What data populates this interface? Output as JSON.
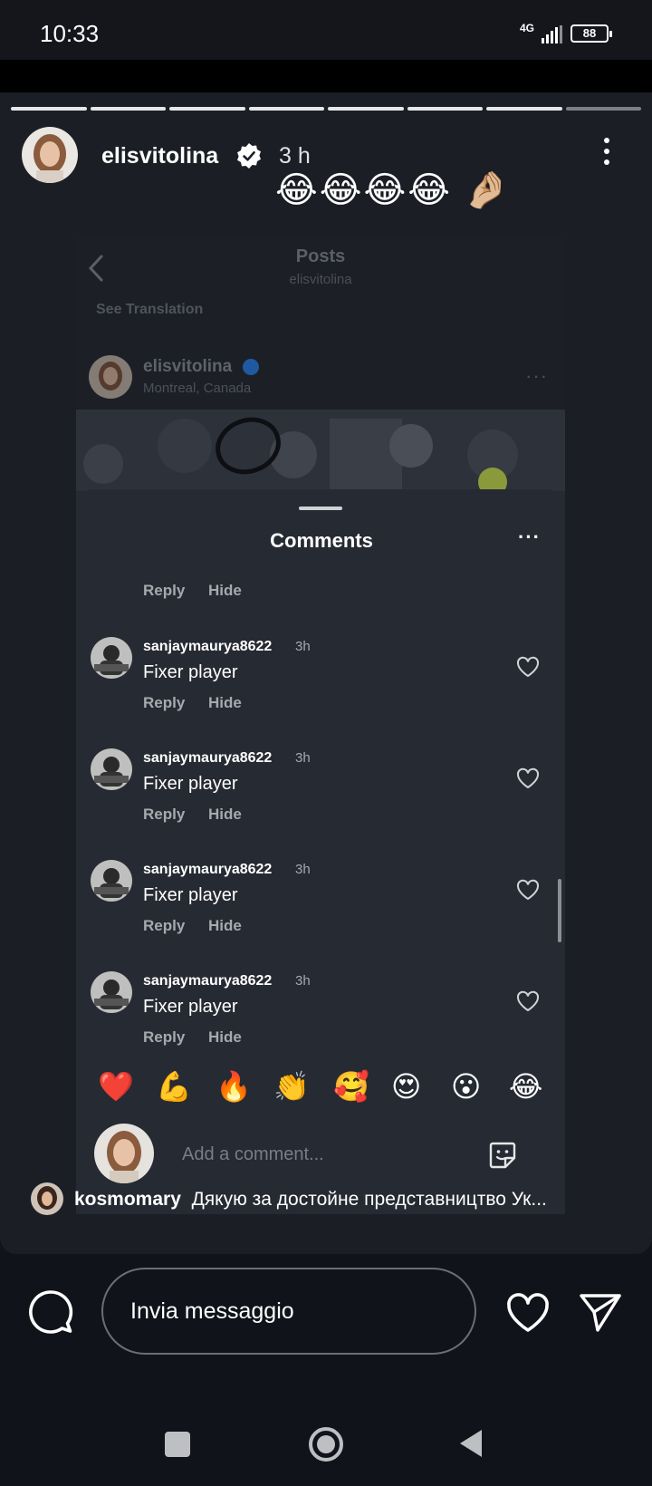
{
  "status_bar": {
    "time": "10:33",
    "network": "4G",
    "battery": "88"
  },
  "story": {
    "username": "elisvitolina",
    "time_ago": "3 h",
    "progress": {
      "segments": 8,
      "viewed": 7
    },
    "caption_emojis": "😂😂😂😂 🤌🏼"
  },
  "embedded_post": {
    "header_title": "Posts",
    "header_subtitle": "elisvitolina",
    "see_translation": "See Translation",
    "author": "elisvitolina",
    "location": "Montreal, Canada"
  },
  "comments_sheet": {
    "title": "Comments",
    "top_reply": {
      "reply": "Reply",
      "hide": "Hide"
    },
    "comments": [
      {
        "user": "sanjaymaurya8622",
        "time": "3h",
        "text": "Fixer player",
        "reply": "Reply",
        "hide": "Hide"
      },
      {
        "user": "sanjaymaurya8622",
        "time": "3h",
        "text": "Fixer player",
        "reply": "Reply",
        "hide": "Hide"
      },
      {
        "user": "sanjaymaurya8622",
        "time": "3h",
        "text": "Fixer player",
        "reply": "Reply",
        "hide": "Hide"
      },
      {
        "user": "sanjaymaurya8622",
        "time": "3h",
        "text": "Fixer player",
        "reply": "Reply",
        "hide": "Hide"
      }
    ],
    "reactions": [
      "❤️",
      "💪",
      "🔥",
      "👏",
      "🥰",
      "😍",
      "😮",
      "😂"
    ],
    "add_comment_placeholder": "Add a comment..."
  },
  "overlay_comment": {
    "user": "kosmomary",
    "text": "Дякую за достойне представництво Ук..."
  },
  "reply_bar": {
    "placeholder": "Invia messaggio"
  },
  "icons": [
    "verified-badge-icon",
    "more-vert-icon",
    "chevron-left-icon",
    "heart-icon",
    "sticker-icon",
    "chat-bubble-icon",
    "send-icon",
    "nav-recents-icon",
    "nav-home-icon",
    "nav-back-icon"
  ]
}
